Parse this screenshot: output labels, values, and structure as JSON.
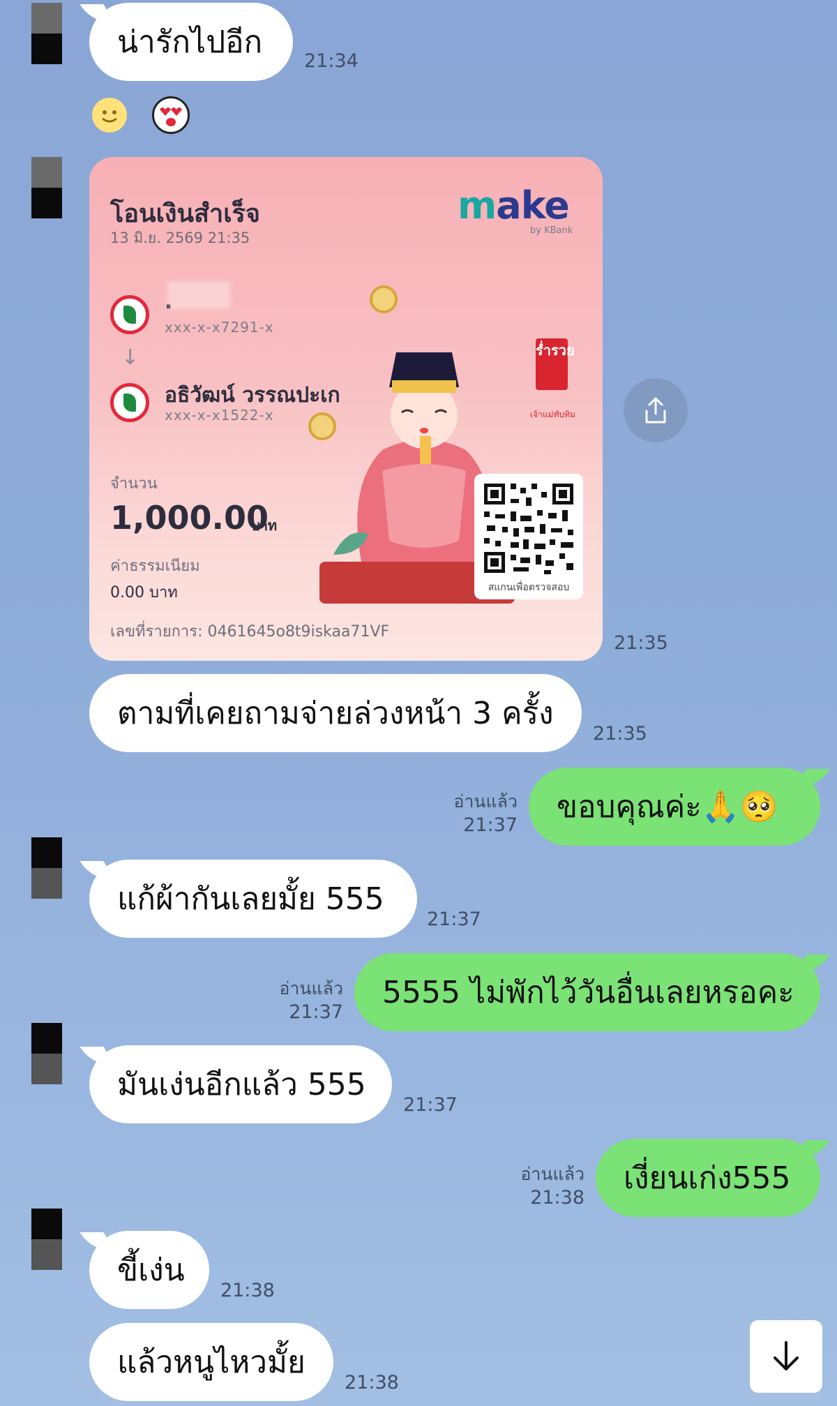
{
  "messages": [
    {
      "side": "left",
      "text": "น่ารักไปอีก",
      "time": "21:34"
    },
    {
      "side": "left",
      "stickers": [
        "slightly-smiling-face",
        "heart-eyes-face"
      ]
    },
    {
      "side": "left",
      "kind": "transfer-slip",
      "time": "21:35"
    },
    {
      "side": "left",
      "text": "ตามที่เคยถามจ่ายล่วงหน้า 3 ครั้ง",
      "time": "21:35"
    },
    {
      "side": "right",
      "text": "ขอบคุณค่ะ🙏🥺",
      "read": "อ่านแล้ว",
      "time": "21:37"
    },
    {
      "side": "left",
      "text": "แก้ผ้ากันเลยมั้ย 555",
      "time": "21:37"
    },
    {
      "side": "right",
      "text": "5555 ไม่พักไว้วันอื่นเลยหรอคะ",
      "read": "อ่านแล้ว",
      "time": "21:37"
    },
    {
      "side": "left",
      "text": "มันเง่นอีกแล้ว 555",
      "time": "21:37"
    },
    {
      "side": "right",
      "text": "เงี่ยนเก่ง555",
      "read": "อ่านแล้ว",
      "time": "21:38"
    },
    {
      "side": "left",
      "text": "ขี้เง่น",
      "time": "21:38"
    },
    {
      "side": "left",
      "text": "แล้วหนูไหวมั้ย",
      "time": "21:38"
    }
  ],
  "slip": {
    "title": "โอนเงินสำเร็จ",
    "date": "13 มิ.ย. 2569 21:35",
    "brand": "make",
    "brand_sub": "by KBank",
    "from_name": ".",
    "from_account": "xxx-x-x7291-x",
    "to_name": "อธิวัฒน์ วรรณปะเก",
    "to_account": "xxx-x-x1522-x",
    "amount_label": "จำนวน",
    "amount": "1,000.00",
    "amount_unit": "บาท",
    "fee_label": "ค่าธรรมเนียม",
    "fee": "0.00 บาท",
    "reference": "เลขที่รายการ: 0461645o8t9iskaa71VF",
    "qr_caption": "สแกนเพื่อตรวจสอบ",
    "badge": "ร่ำรวย",
    "badge_sub": "เจ้าแม่ทับทิม"
  },
  "icons": {
    "share": "share-icon",
    "scroll_down": "arrow-down-icon"
  },
  "colors": {
    "background": "#8fadd9",
    "incoming_bubble": "#ffffff",
    "outgoing_bubble": "#7be276",
    "time_text": "#3f4d66"
  }
}
